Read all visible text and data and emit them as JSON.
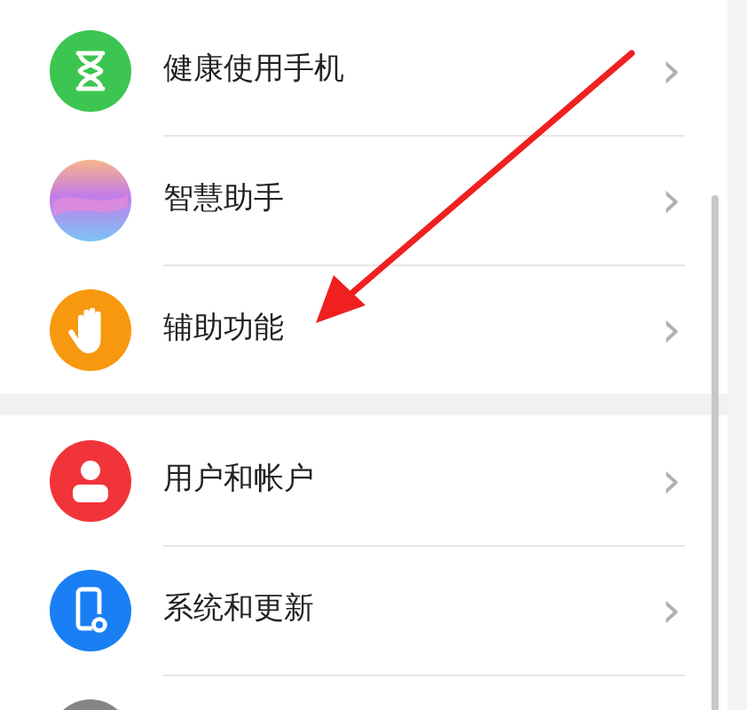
{
  "groups": [
    [
      {
        "label": "健康使用手机"
      },
      {
        "label": "智慧助手"
      },
      {
        "label": "辅助功能"
      }
    ],
    [
      {
        "label": "用户和帐户"
      },
      {
        "label": "系统和更新"
      }
    ]
  ],
  "chevron": "›"
}
